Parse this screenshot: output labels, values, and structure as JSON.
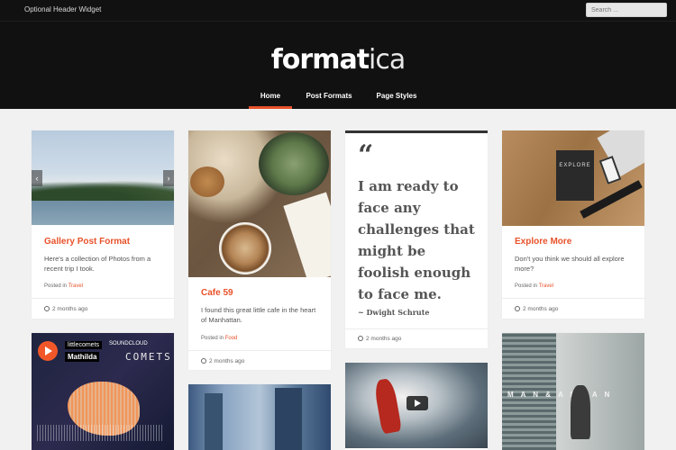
{
  "topbar": {
    "widget_text": "Optional Header Widget",
    "search_placeholder": "Search ..."
  },
  "header": {
    "logo_part1": "format",
    "logo_part2": "ica",
    "nav": [
      {
        "label": "Home",
        "active": true
      },
      {
        "label": "Post Formats",
        "active": false
      },
      {
        "label": "Page Styles",
        "active": false
      }
    ]
  },
  "posts": {
    "gallery": {
      "title": "Gallery Post Format",
      "excerpt": "Here's a collection of Photos from a recent trip I took.",
      "posted_in_label": "Posted in",
      "category": "Travel",
      "date": "2 months ago",
      "prev_icon": "‹",
      "next_icon": "›"
    },
    "cafe": {
      "title": "Cafe 59",
      "excerpt": "I found this great little cafe in the heart of Manhattan.",
      "posted_in_label": "Posted in",
      "category": "Food",
      "date": "2 months ago"
    },
    "quote": {
      "mark": "“",
      "text": "I am ready to face any challenges that might be foolish enough to face me.",
      "author": "~ Dwight Schrute",
      "date": "2 months ago"
    },
    "explore": {
      "title": "Explore More",
      "excerpt": "Don't you think we should all explore more?",
      "posted_in_label": "Posted in",
      "category": "Travel",
      "date": "2 months ago",
      "book_label": "EXPLORE"
    },
    "audio": {
      "user": "littlecomets",
      "track": "Mathilda",
      "soundcloud": "SOUNDCLOUD",
      "art_text": "COMETS"
    },
    "street": {
      "sign": "M A N & A R I A N"
    }
  },
  "colors": {
    "accent": "#e8522a",
    "header_bg": "#111111",
    "page_bg": "#f1f1f1"
  }
}
